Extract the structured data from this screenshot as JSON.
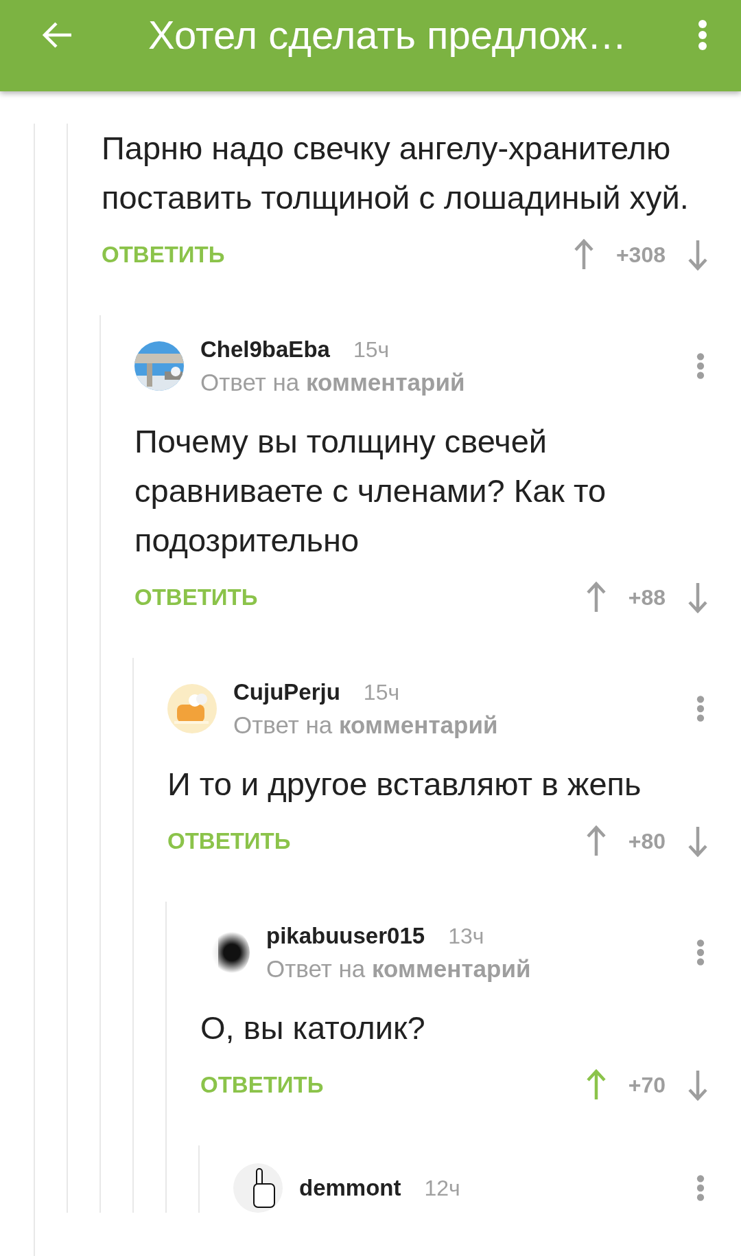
{
  "app_bar": {
    "title": "Хотел сделать предлож…"
  },
  "thread": {
    "body": "Парню надо свечку ангелу-хранителю поставить толщиной с лошадиный хуй.",
    "reply_label": "ОТВЕТИТЬ",
    "score": "+308",
    "voted_up": false,
    "children": [
      {
        "author": "Chel9baEba",
        "time": "15ч",
        "reply_to": "Ответ на **комментарий**",
        "body": "Почему вы толщину свечей сравниваете с членами? Как то подозрительно",
        "reply_label": "ОТВЕТИТЬ",
        "score": "+88",
        "voted_up": false,
        "children": [
          {
            "author": "CujuPerju",
            "time": "15ч",
            "reply_to": "Ответ на **комментарий**",
            "body": "И то и другое вставляют в жепь",
            "reply_label": "ОТВЕТИТЬ",
            "score": "+80",
            "voted_up": false,
            "children": [
              {
                "author": "pikabuuser015",
                "time": "13ч",
                "reply_to": "Ответ на **комментарий**",
                "body": "О, вы католик?",
                "reply_label": "ОТВЕТИТЬ",
                "score": "+70",
                "voted_up": true,
                "children": [
                  {
                    "author": "demmont",
                    "time": "12ч"
                  }
                ]
              }
            ]
          }
        ]
      }
    ]
  }
}
